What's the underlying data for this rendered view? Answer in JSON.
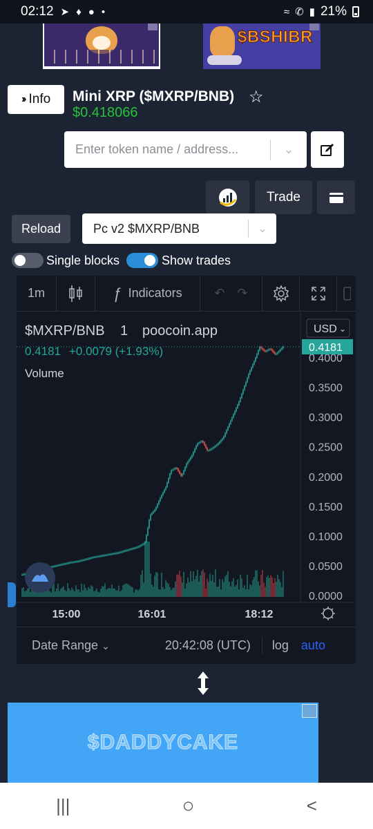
{
  "status_bar": {
    "time": "02:12",
    "battery": "21%"
  },
  "ads": {
    "top_right_text": "$BSHIBR",
    "bottom_text": "$DADDYCAKE"
  },
  "token": {
    "info_label": "Info",
    "title": "Mini XRP ($MXRP/BNB)",
    "price": "$0.418066"
  },
  "search": {
    "placeholder": "Enter token name / address..."
  },
  "actions": {
    "trade_label": "Trade",
    "reload_label": "Reload"
  },
  "pair": {
    "selected": "Pc v2 $MXRP/BNB"
  },
  "toggles": {
    "single_blocks": {
      "label": "Single blocks",
      "on": false
    },
    "show_trades": {
      "label": "Show trades",
      "on": true
    }
  },
  "chart_toolbar": {
    "interval": "1m",
    "indicators_label": "Indicators"
  },
  "chart_header": {
    "symbol": "$MXRP/BNB",
    "interval": "1",
    "source": "poocoin.app",
    "currency": "USD",
    "last": "0.4181",
    "change": "+0.0079 (+1.93%)",
    "volume_label": "Volume"
  },
  "chart_footer": {
    "date_range": "Date Range",
    "clock": "20:42:08 (UTC)",
    "log": "log",
    "auto": "auto"
  },
  "colors": {
    "up": "#26a69a",
    "down": "#ef5350",
    "accent": "#2962ff",
    "price_green": "#27c13a",
    "tag": "#26a69a"
  },
  "chart_data": {
    "type": "candlestick",
    "x_ticks": [
      "15:00",
      "16:01",
      "18:12"
    ],
    "y_ticks": [
      "0.0000",
      "0.0500",
      "0.1000",
      "0.1500",
      "0.2000",
      "0.2500",
      "0.3000",
      "0.3500",
      "0.4000"
    ],
    "ylim": [
      0,
      0.4181
    ],
    "last_price_label": "0.4181",
    "close_trend": [
      [
        0,
        0.035
      ],
      [
        0.04,
        0.04
      ],
      [
        0.08,
        0.045
      ],
      [
        0.13,
        0.05
      ],
      [
        0.18,
        0.055
      ],
      [
        0.22,
        0.058
      ],
      [
        0.27,
        0.064
      ],
      [
        0.32,
        0.068
      ],
      [
        0.37,
        0.072
      ],
      [
        0.4,
        0.076
      ],
      [
        0.44,
        0.081
      ],
      [
        0.47,
        0.088
      ],
      [
        0.48,
        0.11
      ],
      [
        0.49,
        0.135
      ],
      [
        0.51,
        0.145
      ],
      [
        0.53,
        0.165
      ],
      [
        0.55,
        0.182
      ],
      [
        0.57,
        0.21
      ],
      [
        0.59,
        0.215
      ],
      [
        0.61,
        0.2
      ],
      [
        0.63,
        0.222
      ],
      [
        0.65,
        0.235
      ],
      [
        0.67,
        0.255
      ],
      [
        0.69,
        0.26
      ],
      [
        0.71,
        0.243
      ],
      [
        0.73,
        0.248
      ],
      [
        0.75,
        0.255
      ],
      [
        0.77,
        0.265
      ],
      [
        0.79,
        0.285
      ],
      [
        0.81,
        0.305
      ],
      [
        0.83,
        0.325
      ],
      [
        0.85,
        0.35
      ],
      [
        0.87,
        0.375
      ],
      [
        0.89,
        0.395
      ],
      [
        0.91,
        0.418
      ],
      [
        0.93,
        0.41
      ],
      [
        0.95,
        0.415
      ],
      [
        0.97,
        0.405
      ],
      [
        1.0,
        0.4181
      ]
    ]
  },
  "system_nav": {
    "recent": "|||",
    "home": "○",
    "back": "<"
  }
}
